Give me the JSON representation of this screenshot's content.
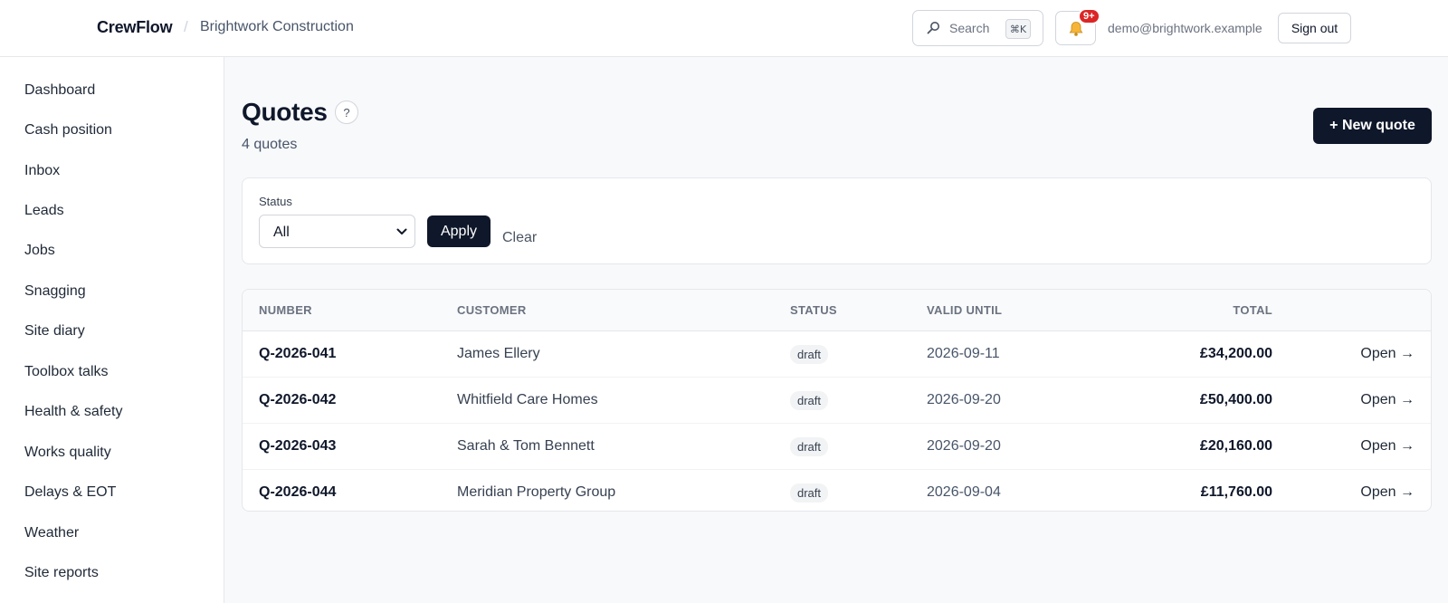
{
  "header": {
    "brand": "CrewFlow",
    "separator": "/",
    "org": "Brightwork Construction",
    "search_label": "Search",
    "search_shortcut": "⌘K",
    "notifications_badge": "9+",
    "user_email": "demo@brightwork.example",
    "signout_label": "Sign out"
  },
  "sidebar": {
    "items": [
      {
        "label": "Dashboard"
      },
      {
        "label": "Cash position"
      },
      {
        "label": "Inbox"
      },
      {
        "label": "Leads"
      },
      {
        "label": "Jobs"
      },
      {
        "label": "Snagging"
      },
      {
        "label": "Site diary"
      },
      {
        "label": "Toolbox talks"
      },
      {
        "label": "Health & safety"
      },
      {
        "label": "Works quality"
      },
      {
        "label": "Delays & EOT"
      },
      {
        "label": "Weather"
      },
      {
        "label": "Site reports"
      }
    ]
  },
  "page": {
    "title": "Quotes",
    "help": "?",
    "subtitle": "4 quotes",
    "new_button": "+ New quote"
  },
  "filter": {
    "status_label": "Status",
    "status_value": "All",
    "apply_label": "Apply",
    "clear_label": "Clear"
  },
  "table": {
    "headers": {
      "number": "NUMBER",
      "customer": "CUSTOMER",
      "status": "STATUS",
      "valid_until": "VALID UNTIL",
      "total": "TOTAL"
    },
    "rows": [
      {
        "number": "Q-2026-041",
        "customer": "James Ellery",
        "status": "draft",
        "valid_until": "2026-09-11",
        "total": "£34,200.00",
        "action": "Open →"
      },
      {
        "number": "Q-2026-042",
        "customer": "Whitfield Care Homes",
        "status": "draft",
        "valid_until": "2026-09-20",
        "total": "£50,400.00",
        "action": "Open →"
      },
      {
        "number": "Q-2026-043",
        "customer": "Sarah & Tom Bennett",
        "status": "draft",
        "valid_until": "2026-09-20",
        "total": "£20,160.00",
        "action": "Open →"
      },
      {
        "number": "Q-2026-044",
        "customer": "Meridian Property Group",
        "status": "draft",
        "valid_until": "2026-09-04",
        "total": "£11,760.00",
        "action": "Open →"
      }
    ]
  },
  "icons": {
    "search": "search-icon",
    "bell": "bell-icon",
    "select": "chevron-down-icon"
  },
  "colors": {
    "primary": "#0f172a",
    "badge": "#dc2626",
    "bell": "#f59e0b"
  }
}
